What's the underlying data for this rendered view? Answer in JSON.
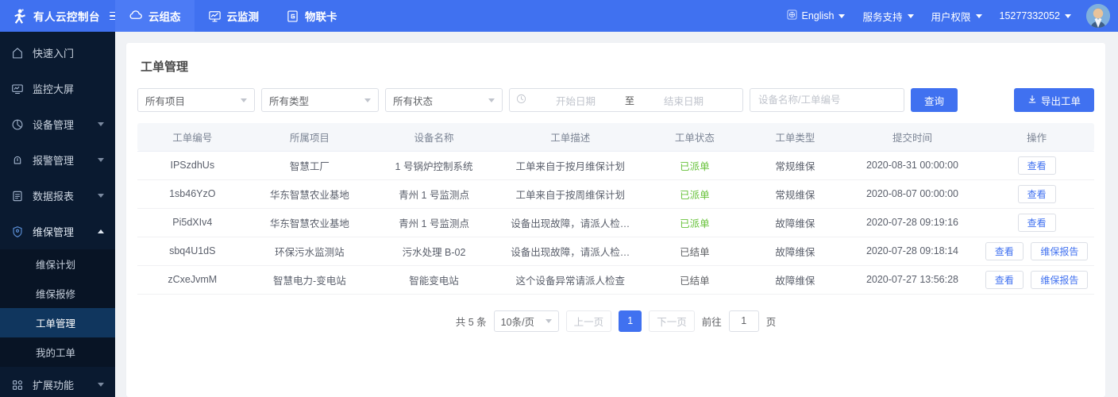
{
  "topbar": {
    "brand_name": "有人云控制台",
    "menu_icon": "hamburger-icon",
    "nav": [
      {
        "label": "云组态",
        "icon": "cloud-icon",
        "active": true
      },
      {
        "label": "云监测",
        "icon": "monitor-icon",
        "active": false
      },
      {
        "label": "物联卡",
        "icon": "sim-card-icon",
        "active": false
      }
    ],
    "right": [
      {
        "label": "English",
        "icon": "globe-icon",
        "caret": true
      },
      {
        "label": "服务支持",
        "caret": true
      },
      {
        "label": "用户权限",
        "caret": true
      },
      {
        "label": "15277332052",
        "caret": true
      }
    ],
    "avatar": "user-avatar"
  },
  "sidebar": {
    "items": [
      {
        "label": "快速入门",
        "icon": "home-icon",
        "expandable": false
      },
      {
        "label": "监控大屏",
        "icon": "screen-icon",
        "expandable": false
      },
      {
        "label": "设备管理",
        "icon": "pie-chart-icon",
        "expandable": true,
        "expanded": false
      },
      {
        "label": "报警管理",
        "icon": "bell-icon",
        "expandable": true,
        "expanded": false
      },
      {
        "label": "数据报表",
        "icon": "report-icon",
        "expandable": true,
        "expanded": false
      },
      {
        "label": "维保管理",
        "icon": "shield-icon",
        "expandable": true,
        "expanded": true
      },
      {
        "label": "扩展功能",
        "icon": "apps-icon",
        "expandable": true,
        "expanded": false
      }
    ],
    "sub_items": [
      {
        "label": "维保计划",
        "active": false
      },
      {
        "label": "维保报修",
        "active": false
      },
      {
        "label": "工单管理",
        "active": true
      },
      {
        "label": "我的工单",
        "active": false
      }
    ]
  },
  "page": {
    "title": "工单管理"
  },
  "filters": {
    "project": "所有项目",
    "type": "所有类型",
    "status": "所有状态",
    "date_start_placeholder": "开始日期",
    "date_separator": "至",
    "date_end_placeholder": "结束日期",
    "keyword_placeholder": "设备名称/工单编号",
    "keyword_value": "",
    "search_label": "查询",
    "export_label": "导出工单",
    "export_icon": "download-icon"
  },
  "table": {
    "columns": [
      "工单编号",
      "所属项目",
      "设备名称",
      "工单描述",
      "工单状态",
      "工单类型",
      "提交时间",
      "操作"
    ],
    "rows": [
      {
        "id": "IPSzdhUs",
        "project": "智慧工厂",
        "device": "1 号锅炉控制系统",
        "desc": "工单来自于按月维保计划",
        "status": "已派单",
        "status_color": "green",
        "type": "常规维保",
        "time": "2020-08-31 00:00:00",
        "actions": [
          "查看"
        ]
      },
      {
        "id": "1sb46YzO",
        "project": "华东智慧农业基地",
        "device": "青州 1 号监测点",
        "desc": "工单来自于按周维保计划",
        "status": "已派单",
        "status_color": "green",
        "type": "常规维保",
        "time": "2020-08-07 00:00:00",
        "actions": [
          "查看"
        ]
      },
      {
        "id": "Pi5dXIv4",
        "project": "华东智慧农业基地",
        "device": "青州 1 号监测点",
        "desc": "设备出现故障，请派人检…",
        "status": "已派单",
        "status_color": "green",
        "type": "故障维保",
        "time": "2020-07-28 09:19:16",
        "actions": [
          "查看"
        ]
      },
      {
        "id": "sbq4U1dS",
        "project": "环保污水监测站",
        "device": "污水处理 B-02",
        "desc": "设备出现故障，请派人检…",
        "status": "已结单",
        "status_color": "gray",
        "type": "故障维保",
        "time": "2020-07-28 09:18:14",
        "actions": [
          "查看",
          "维保报告"
        ]
      },
      {
        "id": "zCxeJvmM",
        "project": "智慧电力-变电站",
        "device": "智能变电站",
        "desc": "这个设备异常请派人检查",
        "status": "已结单",
        "status_color": "gray",
        "type": "故障维保",
        "time": "2020-07-27 13:56:28",
        "actions": [
          "查看",
          "维保报告"
        ]
      }
    ]
  },
  "pagination": {
    "total_label": "共 5 条",
    "page_size": "10条/页",
    "prev_label": "上一页",
    "current_page": "1",
    "next_label": "下一页",
    "goto_label": "前往",
    "goto_value": "1",
    "page_unit": "页"
  },
  "colors": {
    "brand_blue": "#4071f0",
    "active_tab_blue": "#4c7bf5",
    "sidebar_bg": "#0a1a30",
    "sidebar_sub_bg": "#081425",
    "sidebar_active": "#10365e",
    "status_green": "#67c23a",
    "status_gray": "#606266"
  }
}
